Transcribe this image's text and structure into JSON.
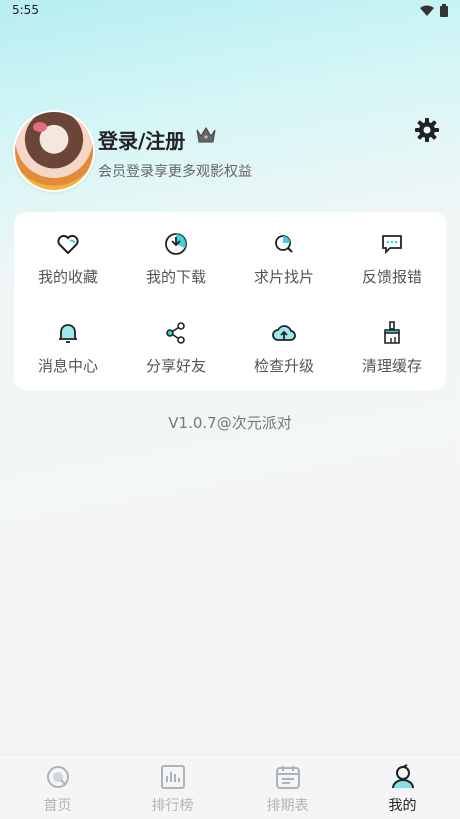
{
  "status_bar": {
    "time": "5:55"
  },
  "profile": {
    "title": "登录/注册",
    "subtitle": "会员登录享更多观影权益"
  },
  "grid": {
    "items": [
      {
        "label": "我的收藏",
        "icon": "heart-icon"
      },
      {
        "label": "我的下载",
        "icon": "download-icon"
      },
      {
        "label": "求片找片",
        "icon": "search-icon"
      },
      {
        "label": "反馈报错",
        "icon": "feedback-icon"
      },
      {
        "label": "消息中心",
        "icon": "bell-icon"
      },
      {
        "label": "分享好友",
        "icon": "share-icon"
      },
      {
        "label": "检查升级",
        "icon": "cloud-upload-icon"
      },
      {
        "label": "清理缓存",
        "icon": "clean-icon"
      }
    ]
  },
  "version": "V1.0.7@次元派对",
  "bottom_nav": {
    "items": [
      {
        "label": "首页",
        "icon": "home-icon",
        "active": false
      },
      {
        "label": "排行榜",
        "icon": "chart-icon",
        "active": false
      },
      {
        "label": "排期表",
        "icon": "calendar-icon",
        "active": false
      },
      {
        "label": "我的",
        "icon": "profile-icon",
        "active": true
      }
    ]
  },
  "colors": {
    "accent": "#3fd2dc",
    "text": "#222222",
    "muted": "#b0b3b6"
  }
}
